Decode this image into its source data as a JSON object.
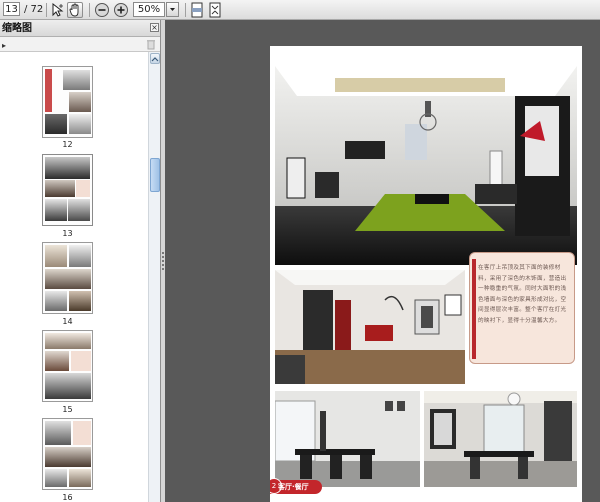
{
  "toolbar": {
    "current_page": "13",
    "total_pages": "/ 72",
    "zoom": "50%"
  },
  "sidebar": {
    "title": "缩略图",
    "thumbnails": [
      {
        "label": "12"
      },
      {
        "label": "13"
      },
      {
        "label": "14"
      },
      {
        "label": "15"
      },
      {
        "label": "16"
      }
    ]
  },
  "page": {
    "caption": "在客厅上吊顶及其下面的装修材料，采用了深色的木饰面，营造出一种稳重的气氛。同时大面积的浅色墙面与深色的家具形成对比，空间显得层次丰富。整个客厅在灯光的映衬下，显得十分温馨大方。",
    "footer_label": "客厅·餐厅",
    "footer_icon": "2"
  },
  "colors": {
    "accent_red": "#c3262b",
    "caption_bg": "#f7e6dc",
    "viewer_bg": "#595959"
  }
}
